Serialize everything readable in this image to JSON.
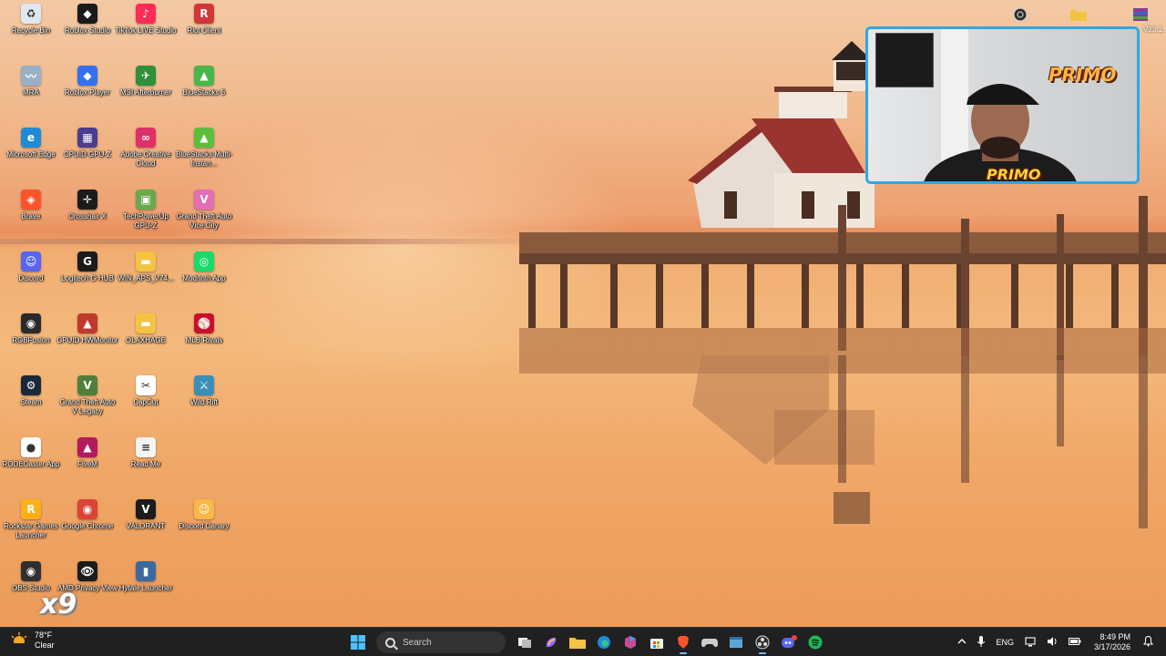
{
  "desktop": {
    "icons": [
      {
        "label": "Recycle Bin",
        "icon": "recycle-bin-icon",
        "color": "#dfe8f0",
        "glyph": "♻"
      },
      {
        "label": "Roblox Studio",
        "icon": "roblox-studio-icon",
        "color": "#1a1a1a",
        "glyph": "◆"
      },
      {
        "label": "TikTok LIVE Studio",
        "icon": "tiktok-live-studio-icon",
        "color": "#fe2c55",
        "glyph": "♪"
      },
      {
        "label": "Riot Client",
        "icon": "riot-client-icon",
        "color": "#d13639",
        "glyph": "R"
      },
      {
        "label": "MRA",
        "icon": "mra-icon",
        "color": "#9ab0c4",
        "glyph": "〰"
      },
      {
        "label": "Roblox Player",
        "icon": "roblox-player-icon",
        "color": "#3370ef",
        "glyph": "◆"
      },
      {
        "label": "MSI Afterburner",
        "icon": "msi-afterburner-icon",
        "color": "#2f8f3a",
        "glyph": "✈"
      },
      {
        "label": "BlueStacks 5",
        "icon": "bluestacks-5-icon",
        "color": "#47b74a",
        "glyph": "▲"
      },
      {
        "label": "Microsoft Edge",
        "icon": "microsoft-edge-icon",
        "color": "#1f8ad6",
        "glyph": "e"
      },
      {
        "label": "CPUID GPU-Z",
        "icon": "cpuid-gpu-z-icon",
        "color": "#4b3c8f",
        "glyph": "▦"
      },
      {
        "label": "Adobe Creative Cloud",
        "icon": "adobe-creative-cloud-icon",
        "color": "#e0306a",
        "glyph": "∞"
      },
      {
        "label": "BlueStacks Multi-Instan...",
        "icon": "bluestacks-multi-instance-icon",
        "color": "#5cbf3c",
        "glyph": "▲"
      },
      {
        "label": "Brave",
        "icon": "brave-icon",
        "color": "#fb542b",
        "glyph": "◈"
      },
      {
        "label": "Crosshair X",
        "icon": "crosshair-x-icon",
        "color": "#1b1b1b",
        "glyph": "✛"
      },
      {
        "label": "TechPowerUp GPU-Z",
        "icon": "techpowerup-gpu-z-icon",
        "color": "#6aa84f",
        "glyph": "▣"
      },
      {
        "label": "Grand Theft Auto Vice City",
        "icon": "gta-vice-city-icon",
        "color": "#e56fb4",
        "glyph": "V"
      },
      {
        "label": "Discord",
        "icon": "discord-icon",
        "color": "#5865f2",
        "glyph": "☺"
      },
      {
        "label": "Logitech G HUB",
        "icon": "logitech-g-hub-icon",
        "color": "#1b1b1b",
        "glyph": "G"
      },
      {
        "label": "WIN_APS_V74...",
        "icon": "folder-icon",
        "color": "#f5c342",
        "glyph": "▬"
      },
      {
        "label": "Modrinth App",
        "icon": "modrinth-app-icon",
        "color": "#1bd96a",
        "glyph": "◎"
      },
      {
        "label": "RGBFusion",
        "icon": "rgbfusion-icon",
        "color": "#2a2a2a",
        "glyph": "◉"
      },
      {
        "label": "CPUID HWMonitor",
        "icon": "cpuid-hwmonitor-icon",
        "color": "#c0392b",
        "glyph": "▲"
      },
      {
        "label": "OLAXHAGE",
        "icon": "folder-icon",
        "color": "#f5c342",
        "glyph": "▬"
      },
      {
        "label": "MLB Rivals",
        "icon": "mlb-rivals-icon",
        "color": "#c8102e",
        "glyph": "⚾"
      },
      {
        "label": "Steam",
        "icon": "steam-icon",
        "color": "#1b2838",
        "glyph": "⚙"
      },
      {
        "label": "Grand Theft Auto V Legacy",
        "icon": "gta-v-legacy-icon",
        "color": "#4f7f3a",
        "glyph": "V"
      },
      {
        "label": "CapCut",
        "icon": "capcut-icon",
        "color": "#ffffff",
        "glyph": "✂"
      },
      {
        "label": "Wild Rift",
        "icon": "wild-rift-icon",
        "color": "#3a8fb7",
        "glyph": "⚔"
      },
      {
        "label": "RODECaster App",
        "icon": "rodecaster-app-icon",
        "color": "#ffffff",
        "glyph": "●"
      },
      {
        "label": "FiveM",
        "icon": "fivem-icon",
        "color": "#b3195f",
        "glyph": "▲"
      },
      {
        "label": "Read Me",
        "icon": "text-document-icon",
        "color": "#f4f4f4",
        "glyph": "≡"
      },
      {
        "label": "",
        "icon": "empty-slot",
        "color": "",
        "glyph": ""
      },
      {
        "label": "Rockstar Games Launcher",
        "icon": "rockstar-games-launcher-icon",
        "color": "#fcaf17",
        "glyph": "R"
      },
      {
        "label": "Google Chrome",
        "icon": "google-chrome-icon",
        "color": "#db4437",
        "glyph": "◉"
      },
      {
        "label": "VALORANT",
        "icon": "valorant-icon",
        "color": "#1b1b1b",
        "glyph": "V"
      },
      {
        "label": "Discord Canary",
        "icon": "discord-canary-icon",
        "color": "#fbb848",
        "glyph": "☺"
      },
      {
        "label": "OBS Studio",
        "icon": "obs-studio-icon",
        "color": "#302e31",
        "glyph": "◉"
      },
      {
        "label": "AMD Privacy View",
        "icon": "amd-privacy-view-icon",
        "color": "#1b1b1b",
        "glyph": "👁"
      },
      {
        "label": "Hytale Launcher",
        "icon": "hytale-launcher-icon",
        "color": "#3b6aa0",
        "glyph": "▮"
      },
      {
        "label": "",
        "icon": "empty-slot",
        "color": "",
        "glyph": ""
      }
    ],
    "top_right": [
      {
        "label": "",
        "icon": "circle-app-icon"
      },
      {
        "label": "",
        "icon": "folder-icon"
      },
      {
        "label": "V23.1...",
        "icon": "winrar-archive-icon"
      }
    ],
    "overlay_counter": "x9"
  },
  "webcam": {
    "logo_top": "PRIMO",
    "logo_bottom": "PRIMO",
    "border_color": "#2fa6e8"
  },
  "taskbar": {
    "weather": {
      "temp": "78°F",
      "condition": "Clear"
    },
    "search_placeholder": "Search",
    "apps": [
      {
        "name": "task-view-button",
        "icon": "task-view-icon"
      },
      {
        "name": "copilot-button",
        "icon": "copilot-icon"
      },
      {
        "name": "file-explorer-button",
        "icon": "folder-icon"
      },
      {
        "name": "edge-button",
        "icon": "edge-icon"
      },
      {
        "name": "microsoft-365-button",
        "icon": "m365-icon"
      },
      {
        "name": "store-button",
        "icon": "store-icon"
      },
      {
        "name": "brave-button",
        "icon": "brave-icon"
      },
      {
        "name": "controller-button",
        "icon": "gamepad-icon"
      },
      {
        "name": "snipping-button",
        "icon": "window-icon"
      },
      {
        "name": "obs-button",
        "icon": "obs-icon"
      },
      {
        "name": "discord-button",
        "icon": "discord-icon"
      },
      {
        "name": "spotify-button",
        "icon": "spotify-icon"
      }
    ],
    "tray": {
      "language": "ENG",
      "time": "8:49 PM",
      "date": "3/17/2026"
    }
  }
}
